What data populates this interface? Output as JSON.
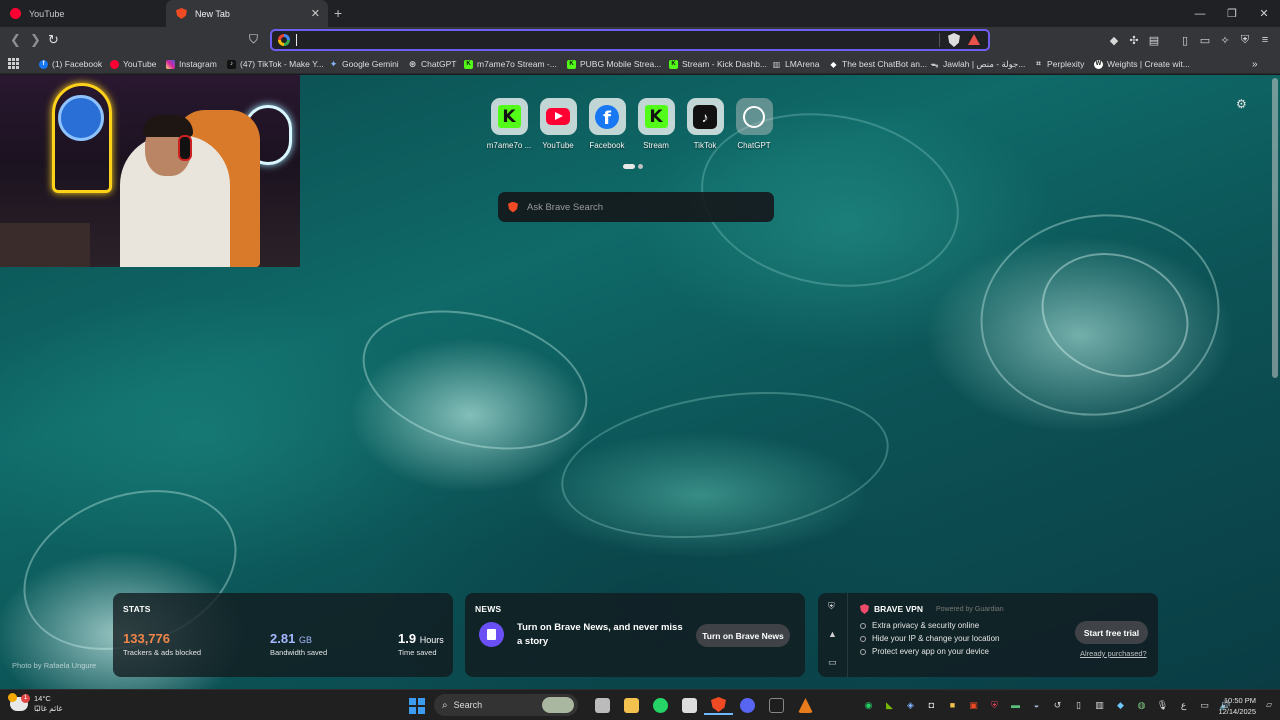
{
  "tabs": [
    {
      "label": "YouTube",
      "icon": "youtube-icon"
    },
    {
      "label": "New Tab",
      "icon": "brave-icon"
    }
  ],
  "bookmarks": [
    {
      "label": "(1) Facebook",
      "icon": "facebook-icon",
      "color": "#1877f2"
    },
    {
      "label": "YouTube",
      "icon": "youtube-icon",
      "color": "#ff0033"
    },
    {
      "label": "Instagram",
      "icon": "instagram-icon",
      "color": "#d6249f"
    },
    {
      "label": "(47) TikTok - Make Y...",
      "icon": "tiktok-icon",
      "color": "#111111"
    },
    {
      "label": "Google Gemini",
      "icon": "gemini-icon",
      "color": "#8ab4f8"
    },
    {
      "label": "ChatGPT",
      "icon": "chatgpt-icon",
      "color": "#bbbbbb"
    },
    {
      "label": "m7ame7o Stream -...",
      "icon": "kick-icon",
      "color": "#53fc18"
    },
    {
      "label": "PUBG Mobile Strea...",
      "icon": "kick-icon",
      "color": "#53fc18"
    },
    {
      "label": "Stream - Kick Dashb...",
      "icon": "kick-icon",
      "color": "#53fc18"
    },
    {
      "label": "LMArena",
      "icon": "lmarena-icon",
      "color": "#bbbbbb"
    },
    {
      "label": "The best ChatBot an...",
      "icon": "chatbot-icon",
      "color": "#ffffff"
    },
    {
      "label": "Jawlah | جولة - منص...",
      "icon": "jawlah-icon",
      "color": "#bbbbbb"
    },
    {
      "label": "Perplexity",
      "icon": "perplexity-icon",
      "color": "#bbbbbb"
    },
    {
      "label": "Weights | Create wit...",
      "icon": "weights-icon",
      "color": "#ffffff"
    }
  ],
  "top_sites": [
    {
      "label": "m7ame7o ...",
      "icon": "kick-icon"
    },
    {
      "label": "YouTube",
      "icon": "youtube-icon"
    },
    {
      "label": "Facebook",
      "icon": "facebook-icon"
    },
    {
      "label": "Stream",
      "icon": "kick-icon"
    },
    {
      "label": "TikTok",
      "icon": "tiktok-icon"
    },
    {
      "label": "ChatGPT",
      "icon": "chatgpt-icon"
    }
  ],
  "search": {
    "placeholder": "Ask Brave Search"
  },
  "photo_credit": "Photo by Rafaela Ungure",
  "stats": {
    "title": "STATS",
    "trackers_value": "133,776",
    "trackers_label": "Trackers & ads blocked",
    "bandwidth_value": "2.81",
    "bandwidth_unit": "GB",
    "bandwidth_label": "Bandwidth saved",
    "time_value": "1.9",
    "time_unit": "Hours",
    "time_label": "Time saved"
  },
  "news": {
    "title": "NEWS",
    "text": "Turn on Brave News, and never miss a story",
    "button": "Turn on Brave News"
  },
  "vpn": {
    "name": "BRAVE VPN",
    "powered_by": "Powered by Guardian",
    "features": [
      "Extra privacy & security online",
      "Hide your IP & change your location",
      "Protect every app on your device"
    ],
    "cta": "Start free trial",
    "already": "Already purchased?"
  },
  "taskbar": {
    "weather_temp": "14°C",
    "weather_desc": "غائم غالبًا",
    "weather_badge": "1",
    "search_label": "Search",
    "time": "10:50 PM",
    "date": "12/14/2025",
    "lang": "ع"
  },
  "colors": {
    "accent": "#6f5ff1",
    "stats_trackers": "#f0864a",
    "stats_bandwidth": "#a6b7ff",
    "stats_time": "#ffffff"
  }
}
